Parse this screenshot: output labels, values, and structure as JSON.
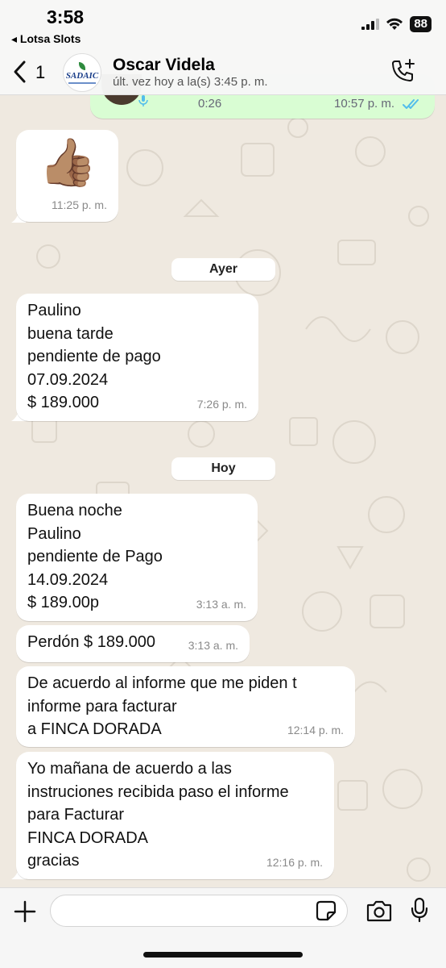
{
  "status_bar": {
    "time": "3:58",
    "back_app": "◂ Lotsa Slots",
    "battery": "88"
  },
  "header": {
    "unread_count": "1",
    "avatar_text": "SADAIC",
    "contact_name": "Oscar Videla",
    "last_seen": "últ. vez hoy a la(s) 3:45 p. m.",
    "call_icon": "phone-plus-icon"
  },
  "messages": {
    "voice_note": {
      "duration": "0:26",
      "time": "10:57 p. m."
    },
    "thumbs_up": {
      "emoji": "👍🏽",
      "time": "11:25 p. m."
    },
    "date_ayer": "Ayer",
    "m1": {
      "text": "Paulino\nbuena tarde\npendiente de pago\n07.09.2024\n$ 189.000",
      "time": "7:26 p. m."
    },
    "date_hoy": "Hoy",
    "m2": {
      "text": "Buena noche\nPaulino\npendiente de Pago\n14.09.2024\n$ 189.00p",
      "time": "3:13 a. m."
    },
    "m3": {
      "text": "Perdón $ 189.000",
      "time": "3:13 a. m."
    },
    "m4": {
      "text": "De acuerdo al informe que me piden t\ninforme para facturar\na FINCA DORADA",
      "time": "12:14 p. m."
    },
    "m5": {
      "text": "Yo mañana de  acuerdo a las\ninstruciones recibida paso el informe\npara Facturar\nFINCA DORADA\ngracias",
      "time": "12:16 p. m."
    }
  },
  "input": {
    "placeholder": "",
    "value": ""
  },
  "colors": {
    "outgoing_bubble": "#d9fdd3",
    "read_ticks": "#53bdeb",
    "wallpaper": "#efe9e0"
  }
}
